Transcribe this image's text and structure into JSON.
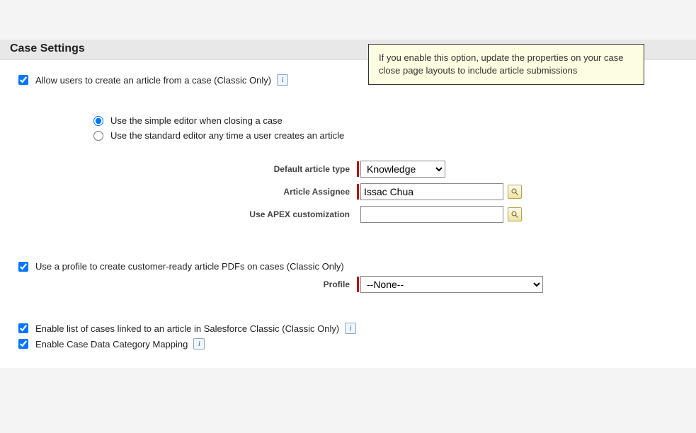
{
  "tooltip": {
    "text": "If you enable this option, update the properties on your case close page layouts to include article submissions"
  },
  "section": {
    "title": "Case Settings"
  },
  "options": {
    "allow_create_article": "Allow users to create an article from a case (Classic Only)",
    "radio_simple": "Use the simple editor when closing a case",
    "radio_standard": "Use the standard editor any time a user creates an article",
    "use_profile_pdf": "Use a profile to create customer-ready article PDFs on cases (Classic Only)",
    "enable_case_list": "Enable list of cases linked to an article in Salesforce Classic (Classic Only)",
    "enable_mapping": "Enable Case Data Category Mapping"
  },
  "fields": {
    "default_article_type": {
      "label": "Default article type",
      "value": "Knowledge"
    },
    "assignee": {
      "label": "Article Assignee",
      "value": "Issac Chua"
    },
    "apex": {
      "label": "Use APEX customization",
      "value": ""
    },
    "profile": {
      "label": "Profile",
      "value": "--None--"
    }
  }
}
